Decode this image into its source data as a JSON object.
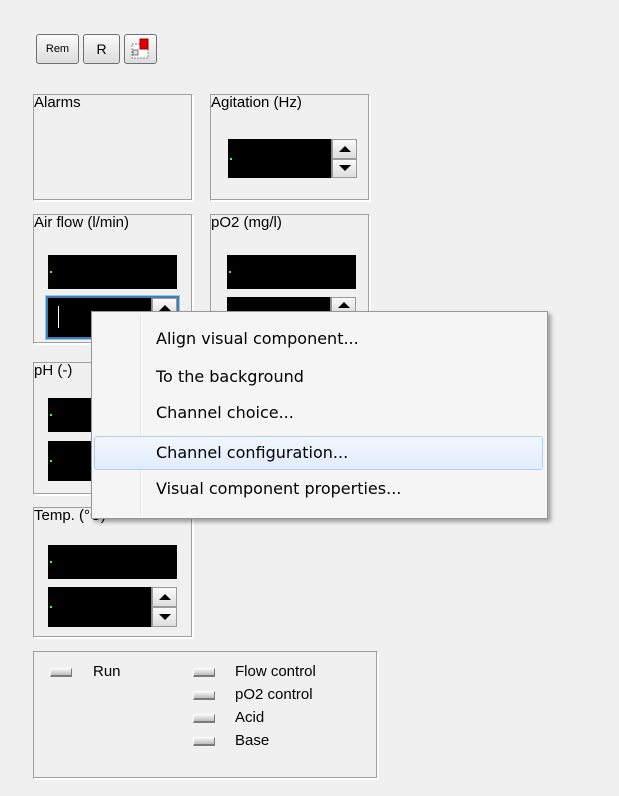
{
  "toolbar": {
    "rem_label": "Rem",
    "r_label": "R",
    "export_icon": "export-icon"
  },
  "groups": {
    "alarms_title": "Alarms",
    "agitation_title": "Agitation (Hz)",
    "airflow_title": "Air flow (l/min)",
    "po2_title": "pO2 (mg/l)",
    "ph_title": "pH (-)",
    "temp_title": "Temp. (°C)"
  },
  "status": {
    "run": "Run",
    "flow_control": "Flow control",
    "po2_control": "pO2 control",
    "acid": "Acid",
    "base": "Base"
  },
  "context_menu": {
    "items": [
      "Align visual component...",
      "To the background",
      "Channel choice...",
      "Channel configuration...",
      "Visual component properties..."
    ],
    "highlighted_index": 3
  },
  "colors": {
    "display_bg": "#000000",
    "display_cursor": "#3cff3c",
    "highlight_border": "#aecff7"
  }
}
